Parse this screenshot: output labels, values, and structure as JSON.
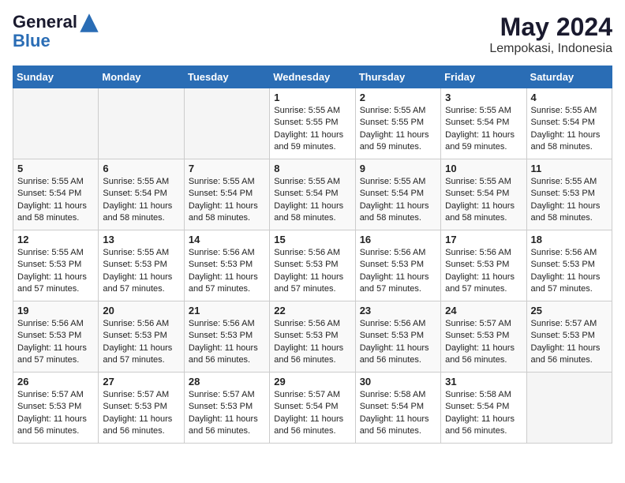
{
  "header": {
    "logo_line1": "General",
    "logo_line2": "Blue",
    "month_year": "May 2024",
    "location": "Lempokasi, Indonesia"
  },
  "days_of_week": [
    "Sunday",
    "Monday",
    "Tuesday",
    "Wednesday",
    "Thursday",
    "Friday",
    "Saturday"
  ],
  "weeks": [
    [
      {
        "day": "",
        "empty": true
      },
      {
        "day": "",
        "empty": true
      },
      {
        "day": "",
        "empty": true
      },
      {
        "day": "1",
        "sunrise": "5:55 AM",
        "sunset": "5:55 PM",
        "daylight": "11 hours and 59 minutes."
      },
      {
        "day": "2",
        "sunrise": "5:55 AM",
        "sunset": "5:55 PM",
        "daylight": "11 hours and 59 minutes."
      },
      {
        "day": "3",
        "sunrise": "5:55 AM",
        "sunset": "5:54 PM",
        "daylight": "11 hours and 59 minutes."
      },
      {
        "day": "4",
        "sunrise": "5:55 AM",
        "sunset": "5:54 PM",
        "daylight": "11 hours and 58 minutes."
      }
    ],
    [
      {
        "day": "5",
        "sunrise": "5:55 AM",
        "sunset": "5:54 PM",
        "daylight": "11 hours and 58 minutes."
      },
      {
        "day": "6",
        "sunrise": "5:55 AM",
        "sunset": "5:54 PM",
        "daylight": "11 hours and 58 minutes."
      },
      {
        "day": "7",
        "sunrise": "5:55 AM",
        "sunset": "5:54 PM",
        "daylight": "11 hours and 58 minutes."
      },
      {
        "day": "8",
        "sunrise": "5:55 AM",
        "sunset": "5:54 PM",
        "daylight": "11 hours and 58 minutes."
      },
      {
        "day": "9",
        "sunrise": "5:55 AM",
        "sunset": "5:54 PM",
        "daylight": "11 hours and 58 minutes."
      },
      {
        "day": "10",
        "sunrise": "5:55 AM",
        "sunset": "5:54 PM",
        "daylight": "11 hours and 58 minutes."
      },
      {
        "day": "11",
        "sunrise": "5:55 AM",
        "sunset": "5:53 PM",
        "daylight": "11 hours and 58 minutes."
      }
    ],
    [
      {
        "day": "12",
        "sunrise": "5:55 AM",
        "sunset": "5:53 PM",
        "daylight": "11 hours and 57 minutes."
      },
      {
        "day": "13",
        "sunrise": "5:55 AM",
        "sunset": "5:53 PM",
        "daylight": "11 hours and 57 minutes."
      },
      {
        "day": "14",
        "sunrise": "5:56 AM",
        "sunset": "5:53 PM",
        "daylight": "11 hours and 57 minutes."
      },
      {
        "day": "15",
        "sunrise": "5:56 AM",
        "sunset": "5:53 PM",
        "daylight": "11 hours and 57 minutes."
      },
      {
        "day": "16",
        "sunrise": "5:56 AM",
        "sunset": "5:53 PM",
        "daylight": "11 hours and 57 minutes."
      },
      {
        "day": "17",
        "sunrise": "5:56 AM",
        "sunset": "5:53 PM",
        "daylight": "11 hours and 57 minutes."
      },
      {
        "day": "18",
        "sunrise": "5:56 AM",
        "sunset": "5:53 PM",
        "daylight": "11 hours and 57 minutes."
      }
    ],
    [
      {
        "day": "19",
        "sunrise": "5:56 AM",
        "sunset": "5:53 PM",
        "daylight": "11 hours and 57 minutes."
      },
      {
        "day": "20",
        "sunrise": "5:56 AM",
        "sunset": "5:53 PM",
        "daylight": "11 hours and 57 minutes."
      },
      {
        "day": "21",
        "sunrise": "5:56 AM",
        "sunset": "5:53 PM",
        "daylight": "11 hours and 56 minutes."
      },
      {
        "day": "22",
        "sunrise": "5:56 AM",
        "sunset": "5:53 PM",
        "daylight": "11 hours and 56 minutes."
      },
      {
        "day": "23",
        "sunrise": "5:56 AM",
        "sunset": "5:53 PM",
        "daylight": "11 hours and 56 minutes."
      },
      {
        "day": "24",
        "sunrise": "5:57 AM",
        "sunset": "5:53 PM",
        "daylight": "11 hours and 56 minutes."
      },
      {
        "day": "25",
        "sunrise": "5:57 AM",
        "sunset": "5:53 PM",
        "daylight": "11 hours and 56 minutes."
      }
    ],
    [
      {
        "day": "26",
        "sunrise": "5:57 AM",
        "sunset": "5:53 PM",
        "daylight": "11 hours and 56 minutes."
      },
      {
        "day": "27",
        "sunrise": "5:57 AM",
        "sunset": "5:53 PM",
        "daylight": "11 hours and 56 minutes."
      },
      {
        "day": "28",
        "sunrise": "5:57 AM",
        "sunset": "5:53 PM",
        "daylight": "11 hours and 56 minutes."
      },
      {
        "day": "29",
        "sunrise": "5:57 AM",
        "sunset": "5:54 PM",
        "daylight": "11 hours and 56 minutes."
      },
      {
        "day": "30",
        "sunrise": "5:58 AM",
        "sunset": "5:54 PM",
        "daylight": "11 hours and 56 minutes."
      },
      {
        "day": "31",
        "sunrise": "5:58 AM",
        "sunset": "5:54 PM",
        "daylight": "11 hours and 56 minutes."
      },
      {
        "day": "",
        "empty": true
      }
    ]
  ],
  "labels": {
    "sunrise_prefix": "Sunrise: ",
    "sunset_prefix": "Sunset: ",
    "daylight_prefix": "Daylight: "
  }
}
